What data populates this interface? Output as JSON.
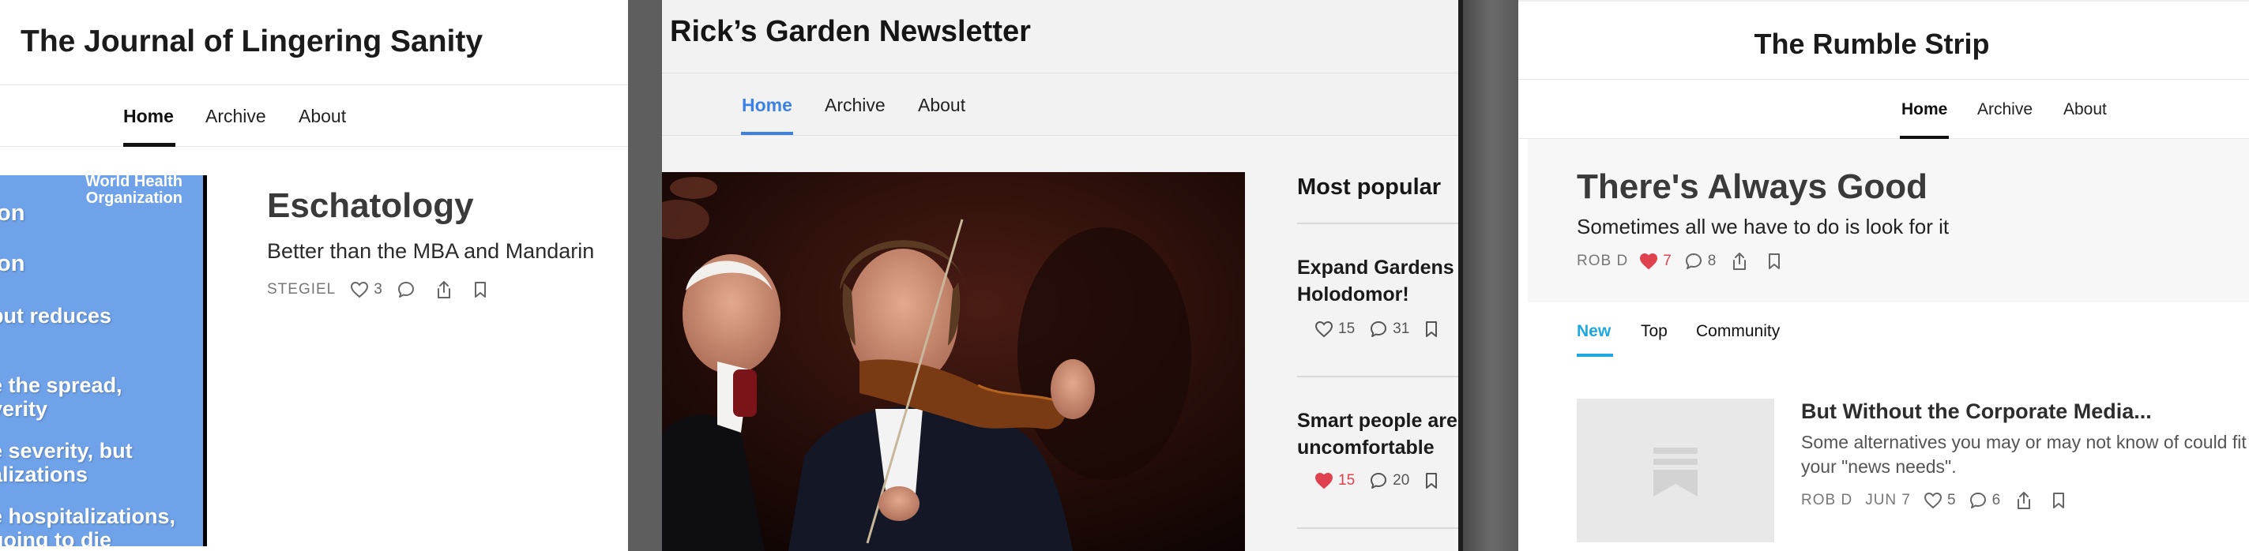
{
  "panel_a": {
    "title": "The Journal of Lingering Sanity",
    "nav": [
      "Home",
      "Archive",
      "About"
    ],
    "banner": {
      "org": "World Health Organization",
      "lines": [
        "ion",
        "ion",
        " but reduces",
        "e the spread,",
        "verity",
        "e severity, but",
        "alizations",
        "e hospitalizations,",
        "going to die"
      ]
    },
    "post": {
      "title": "Eschatology",
      "subtitle": "Better than the MBA and Mandarin",
      "author": "STEGIEL",
      "likes": "3"
    }
  },
  "panel_b": {
    "title": "Rick’s Garden Newsletter",
    "nav": [
      "Home",
      "Archive",
      "About"
    ],
    "side_title": "Most popular",
    "items": [
      {
        "line1": "Expand Gardens",
        "line2": "Holodomor!",
        "likes": "15",
        "comments": "31",
        "liked": false
      },
      {
        "line1": "Smart people are",
        "line2": "uncomfortable",
        "likes": "15",
        "comments": "20",
        "liked": true
      }
    ],
    "colors": {
      "accent": "#3c82e6",
      "heart_active": "#e0414f"
    }
  },
  "panel_c": {
    "title": "The Rumble Strip",
    "nav": [
      "Home",
      "Archive",
      "About"
    ],
    "hero": {
      "title": "There's Always Good",
      "subtitle": "Sometimes all we have to do is look for it",
      "author": "ROB D",
      "likes": "7",
      "comments": "8"
    },
    "tabs": [
      "New",
      "Top",
      "Community"
    ],
    "post": {
      "title": "But Without the Corporate Media...",
      "excerpt": "Some alternatives you may or may not know of could fit your \"news needs\".",
      "author": "ROB D",
      "date": "JUN 7",
      "likes": "5",
      "comments": "6"
    },
    "colors": {
      "accent": "#1ea7e1",
      "heart_active": "#e0414f"
    }
  }
}
